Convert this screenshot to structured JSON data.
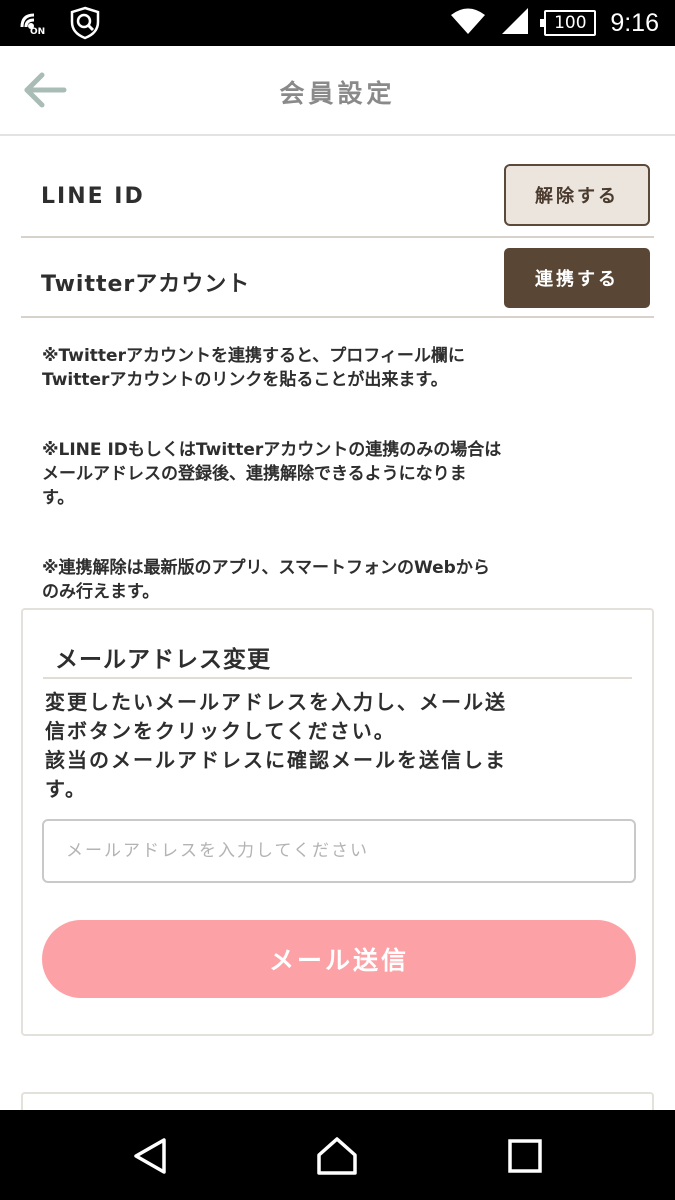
{
  "status_bar": {
    "nfc_label": "ON",
    "battery": "100",
    "time": "9:16"
  },
  "header": {
    "title": "会員設定"
  },
  "accounts": {
    "line": {
      "label": "LINE ID",
      "button": "解除する"
    },
    "twitter": {
      "label": "Twitterアカウント",
      "button": "連携する"
    }
  },
  "notes": [
    "※Twitterアカウントを連携すると、プロフィール欄に\nTwitterアカウントのリンクを貼ることが出来ます。",
    "※LINE IDもしくはTwitterアカウントの連携のみの場合は\nメールアドレスの登録後、連携解除できるようになりま\nす。",
    "※連携解除は最新版のアプリ、スマートフォンのWebから\nのみ行えます。"
  ],
  "email_change": {
    "title": "メールアドレス変更",
    "description": "変更したいメールアドレスを入力し、メール送\n信ボタンをクリックしてください。\n該当のメールアドレスに確認メールを送信しま\nす。",
    "input_value": "",
    "input_placeholder": "メールアドレスを入力してください",
    "send_button": "メール送信"
  },
  "icons": {
    "back": "arrow-left-icon",
    "nav_back": "triangle-back-icon",
    "nav_home": "home-circle-icon",
    "nav_recent": "square-recent-icon"
  },
  "colors": {
    "accent_brown": "#594634",
    "unlink_bg": "#ece5dd",
    "send_pink": "#fca2a6",
    "back_arrow": "#a9bcb6"
  }
}
